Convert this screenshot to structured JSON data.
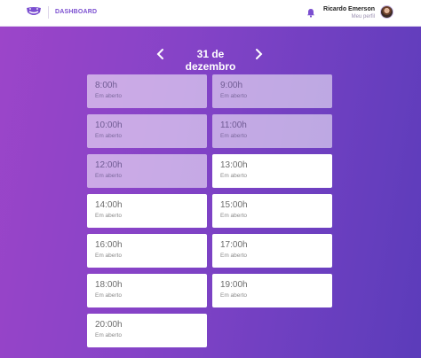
{
  "header": {
    "nav_label": "DASHBOARD",
    "user_name": "Ricardo Emerson",
    "profile_link": "Meu perfil",
    "brand_color": "#7b4fd0",
    "icons": [
      "logo-icon",
      "bell-icon",
      "avatar"
    ]
  },
  "date_nav": {
    "date_label": "31 de dezembro",
    "prev_icon": "chevron-left-icon",
    "next_icon": "chevron-right-icon"
  },
  "colors": {
    "gradient_start": "#9c45c9",
    "gradient_end": "#5b3cba",
    "slot_available": "#ffffff"
  },
  "slots": [
    {
      "time": "8:00h",
      "status": "Em aberto",
      "past": true
    },
    {
      "time": "9:00h",
      "status": "Em aberto",
      "past": true
    },
    {
      "time": "10:00h",
      "status": "Em aberto",
      "past": true
    },
    {
      "time": "11:00h",
      "status": "Em aberto",
      "past": true
    },
    {
      "time": "12:00h",
      "status": "Em aberto",
      "past": true
    },
    {
      "time": "13:00h",
      "status": "Em aberto",
      "past": false
    },
    {
      "time": "14:00h",
      "status": "Em aberto",
      "past": false
    },
    {
      "time": "15:00h",
      "status": "Em aberto",
      "past": false
    },
    {
      "time": "16:00h",
      "status": "Em aberto",
      "past": false
    },
    {
      "time": "17:00h",
      "status": "Em aberto",
      "past": false
    },
    {
      "time": "18:00h",
      "status": "Em aberto",
      "past": false
    },
    {
      "time": "19:00h",
      "status": "Em aberto",
      "past": false
    },
    {
      "time": "20:00h",
      "status": "Em aberto",
      "past": false
    }
  ]
}
